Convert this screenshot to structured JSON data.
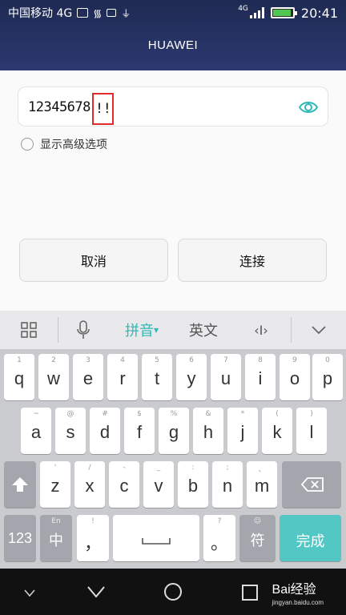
{
  "status": {
    "carrier": "中国移动 4G",
    "network": "4G",
    "time": "20:41"
  },
  "header": {
    "title": "HUAWEI"
  },
  "form": {
    "password_main": "12345678",
    "password_highlight": "!!",
    "advanced_label": "显示高级选项",
    "cancel_label": "取消",
    "connect_label": "连接"
  },
  "keyboard_bar": {
    "pinyin": "拼音",
    "english": "英文",
    "cursor": "‹I›"
  },
  "keyboard": {
    "row1": [
      {
        "m": "q",
        "h": "1"
      },
      {
        "m": "w",
        "h": "2"
      },
      {
        "m": "e",
        "h": "3"
      },
      {
        "m": "r",
        "h": "4"
      },
      {
        "m": "t",
        "h": "5"
      },
      {
        "m": "y",
        "h": "6"
      },
      {
        "m": "u",
        "h": "7"
      },
      {
        "m": "i",
        "h": "8"
      },
      {
        "m": "o",
        "h": "9"
      },
      {
        "m": "p",
        "h": "0"
      }
    ],
    "row2": [
      {
        "m": "a",
        "h": "~"
      },
      {
        "m": "s",
        "h": "@"
      },
      {
        "m": "d",
        "h": "#"
      },
      {
        "m": "f",
        "h": "$"
      },
      {
        "m": "g",
        "h": "%"
      },
      {
        "m": "h",
        "h": "&"
      },
      {
        "m": "j",
        "h": "*"
      },
      {
        "m": "k",
        "h": "("
      },
      {
        "m": "l",
        "h": ")"
      }
    ],
    "row3": [
      {
        "m": "z",
        "h": "'"
      },
      {
        "m": "x",
        "h": "/"
      },
      {
        "m": "c",
        "h": "-"
      },
      {
        "m": "v",
        "h": "_"
      },
      {
        "m": "b",
        "h": ":"
      },
      {
        "m": "n",
        "h": ";"
      },
      {
        "m": "m",
        "h": "、"
      }
    ],
    "num_label": "123",
    "lang_label": "中",
    "lang_hint": "En",
    "comma": "，",
    "comma_hint": "!",
    "period": "。",
    "period_hint": "?",
    "symbol": "符",
    "done": "完成"
  },
  "watermark": {
    "brand": "Bai经验",
    "url": "jingyan.baidu.com"
  },
  "colors": {
    "accent": "#52c7c4",
    "highlight_box": "#e02b2b",
    "header_bg": "#1e2a52"
  }
}
